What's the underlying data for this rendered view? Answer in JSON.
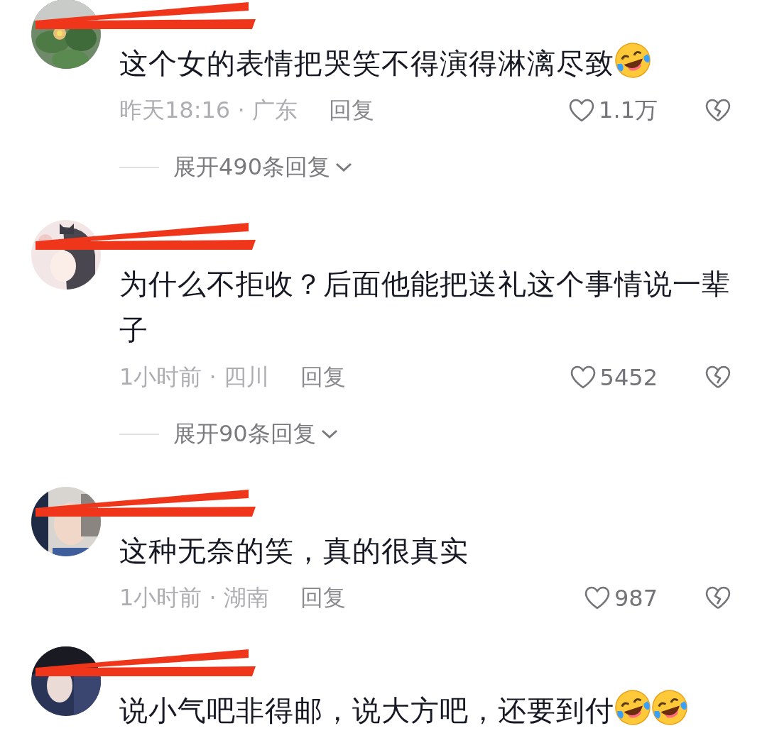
{
  "comments": [
    {
      "text": "这个女的表情把哭笑不得演得淋漓尽致",
      "emojis": [
        {
          "kind": "laugh-cry"
        }
      ],
      "time_location": "昨天18:16 · 广东",
      "reply": "回复",
      "likes": "1.1万",
      "expand": "展开490条回复"
    },
    {
      "text": "为什么不拒收？后面他能把送礼这个事情说一辈子",
      "time_location": "1小时前 · 四川",
      "reply": "回复",
      "likes": "5452",
      "expand": "展开90条回复"
    },
    {
      "text": "这种无奈的笑，真的很真实",
      "time_location": "1小时前 · 湖南",
      "reply": "回复",
      "likes": "987"
    },
    {
      "text": "说小气吧非得邮，说大方吧，还要到付",
      "emojis": [
        {
          "kind": "laugh-cry"
        },
        {
          "kind": "laugh-cry"
        }
      ]
    }
  ]
}
